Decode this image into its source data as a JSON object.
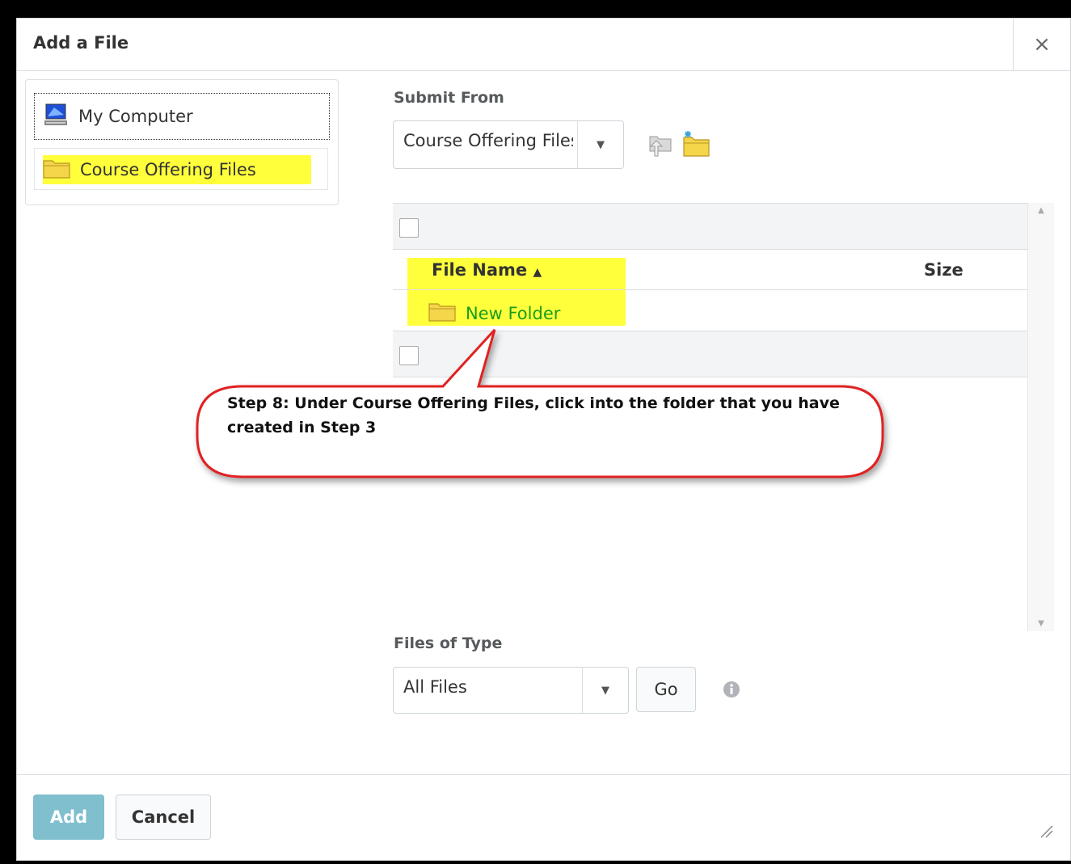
{
  "dialog": {
    "title": "Add a File",
    "close_label": "×"
  },
  "sources": {
    "my_computer": "My Computer",
    "course_offering_files": "Course Offering Files"
  },
  "submit_from": {
    "label": "Submit From",
    "selected": "Course Offering Files"
  },
  "file_list": {
    "col_file_name": "File Name",
    "sort_indicator": "▲",
    "col_size": "Size",
    "items": [
      {
        "name": "New Folder",
        "size": ""
      }
    ]
  },
  "callout": {
    "text": "Step 8: Under Course Offering Files, click into the folder that you have created in Step 3"
  },
  "files_of_type": {
    "label": "Files of Type",
    "selected": "All Files",
    "go_label": "Go"
  },
  "footer": {
    "add_label": "Add",
    "cancel_label": "Cancel"
  },
  "colors": {
    "highlight": "#ffff3c",
    "link": "#1a9e1a",
    "callout_border": "#e02020",
    "primary_button": "#7fbfce"
  }
}
